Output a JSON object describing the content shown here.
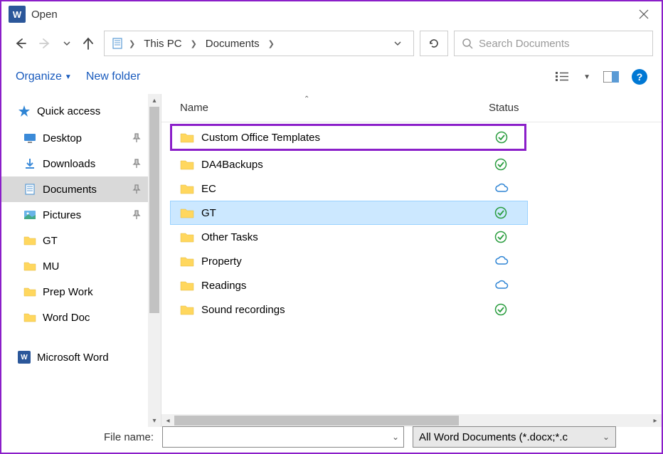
{
  "window": {
    "title": "Open"
  },
  "address": {
    "crumbs": [
      "This PC",
      "Documents"
    ],
    "dropdown": "⌄"
  },
  "search": {
    "placeholder": "Search Documents"
  },
  "toolbar": {
    "organize": "Organize",
    "new_folder": "New folder"
  },
  "sidebar": {
    "quick_access": "Quick access",
    "items": [
      {
        "label": "Desktop",
        "pinned": true,
        "type": "desktop"
      },
      {
        "label": "Downloads",
        "pinned": true,
        "type": "downloads"
      },
      {
        "label": "Documents",
        "pinned": true,
        "type": "documents",
        "selected": true
      },
      {
        "label": "Pictures",
        "pinned": true,
        "type": "pictures"
      },
      {
        "label": "GT",
        "pinned": false,
        "type": "folder"
      },
      {
        "label": "MU",
        "pinned": false,
        "type": "folder"
      },
      {
        "label": "Prep Work",
        "pinned": false,
        "type": "folder"
      },
      {
        "label": "Word Doc",
        "pinned": false,
        "type": "folder"
      }
    ],
    "word_item": "Microsoft Word"
  },
  "columns": {
    "name": "Name",
    "status": "Status"
  },
  "files": [
    {
      "name": "Custom Office Templates",
      "status": "sync",
      "highlight": true
    },
    {
      "name": "DA4Backups",
      "status": "sync"
    },
    {
      "name": "EC",
      "status": "cloud"
    },
    {
      "name": "GT",
      "status": "sync",
      "selected": true
    },
    {
      "name": "Other Tasks",
      "status": "sync"
    },
    {
      "name": "Property",
      "status": "cloud"
    },
    {
      "name": "Readings",
      "status": "cloud"
    },
    {
      "name": "Sound recordings",
      "status": "sync"
    }
  ],
  "bottom": {
    "filename_label": "File name:",
    "filename_value": "",
    "filetype": "All Word Documents (*.docx;*.c"
  }
}
